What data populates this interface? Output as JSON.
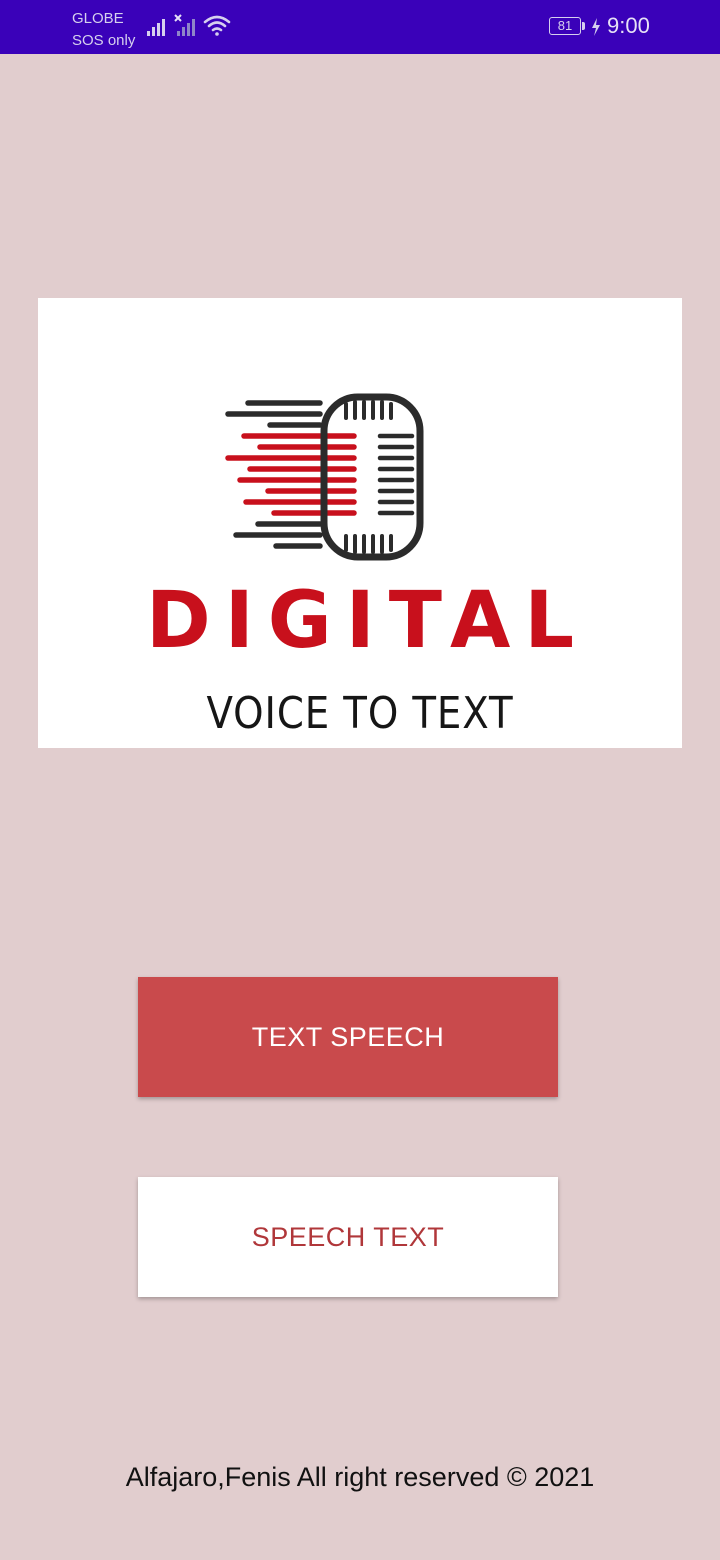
{
  "status_bar": {
    "carrier_line1": "GLOBE",
    "carrier_line2": "SOS only",
    "battery_level": "81",
    "time": "9:00",
    "background_color": "#3a01b9",
    "icons": [
      "signal-bars-icon",
      "signal-bars-no-service-icon",
      "wifi-icon",
      "battery-icon",
      "charging-bolt-icon"
    ]
  },
  "logo": {
    "brand_text": "DIGITAL",
    "subtitle": "VOICE TO TEXT",
    "icon": "microphone-logo-icon",
    "brand_color": "#c8101c"
  },
  "buttons": {
    "text_speech_label": "TEXT SPEECH",
    "speech_text_label": "SPEECH TEXT"
  },
  "footer": {
    "text": "Alfajaro,Fenis All right reserved © 2021"
  },
  "colors": {
    "page_background": "#e1cdce",
    "primary_button": "#c94a4c",
    "secondary_button_text": "#b0373a"
  }
}
